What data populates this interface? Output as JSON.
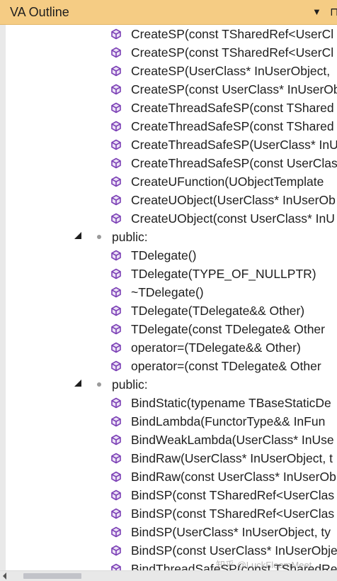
{
  "window": {
    "title": "VA Outline",
    "dropdown_icon": "▼",
    "pin_icon": "⊓"
  },
  "colors": {
    "titlebar": "#f5cc84",
    "symbol": "#7b3fb5"
  },
  "rows": [
    {
      "kind": "item",
      "text": "CreateSP(const TSharedRef<UserCl"
    },
    {
      "kind": "item",
      "text": "CreateSP(const TSharedRef<UserCl"
    },
    {
      "kind": "item",
      "text": "CreateSP(UserClass* InUserObject,"
    },
    {
      "kind": "item",
      "text": "CreateSP(const UserClass* InUserOb"
    },
    {
      "kind": "item",
      "text": "CreateThreadSafeSP(const TShared"
    },
    {
      "kind": "item",
      "text": "CreateThreadSafeSP(const TShared"
    },
    {
      "kind": "item",
      "text": "CreateThreadSafeSP(UserClass* InU"
    },
    {
      "kind": "item",
      "text": "CreateThreadSafeSP(const UserClas"
    },
    {
      "kind": "item",
      "text": "CreateUFunction(UObjectTemplate"
    },
    {
      "kind": "item",
      "text": "CreateUObject(UserClass* InUserOb"
    },
    {
      "kind": "item",
      "text": "CreateUObject(const UserClass* InU"
    },
    {
      "kind": "group",
      "text": "public:"
    },
    {
      "kind": "item",
      "text": "TDelegate()"
    },
    {
      "kind": "item",
      "text": "TDelegate(TYPE_OF_NULLPTR)"
    },
    {
      "kind": "item",
      "text": "~TDelegate()"
    },
    {
      "kind": "item",
      "text": "TDelegate(TDelegate&& Other)"
    },
    {
      "kind": "item",
      "text": "TDelegate(const TDelegate& Other"
    },
    {
      "kind": "item",
      "text": "operator=(TDelegate&& Other)"
    },
    {
      "kind": "item",
      "text": "operator=(const TDelegate& Other"
    },
    {
      "kind": "group",
      "text": "public:"
    },
    {
      "kind": "item",
      "text": "BindStatic(typename TBaseStaticDe"
    },
    {
      "kind": "item",
      "text": "BindLambda(FunctorType&& InFun"
    },
    {
      "kind": "item",
      "text": "BindWeakLambda(UserClass* InUse"
    },
    {
      "kind": "item",
      "text": "BindRaw(UserClass* InUserObject, t"
    },
    {
      "kind": "item",
      "text": "BindRaw(const UserClass* InUserOb"
    },
    {
      "kind": "item",
      "text": "BindSP(const TSharedRef<UserClas"
    },
    {
      "kind": "item",
      "text": "BindSP(const TSharedRef<UserClas"
    },
    {
      "kind": "item",
      "text": "BindSP(UserClass* InUserObject, ty"
    },
    {
      "kind": "item",
      "text": "BindSP(const UserClass* InUserObje"
    },
    {
      "kind": "item",
      "text": "BindThreadSafeSP(const TSharedRe"
    }
  ],
  "watermark": "知乎 @LuckFleemMeet"
}
